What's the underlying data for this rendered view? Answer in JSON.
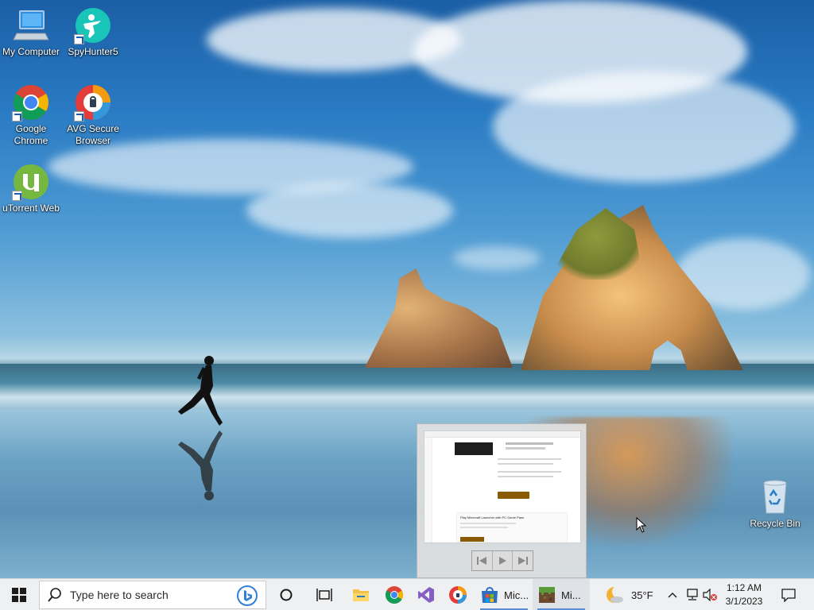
{
  "desktop": {
    "icons": [
      {
        "label": "My Computer",
        "icon": "computer-icon"
      },
      {
        "label": "SpyHunter5",
        "icon": "spyhunter-icon"
      },
      {
        "label": "Google Chrome",
        "icon": "chrome-icon"
      },
      {
        "label": "AVG Secure Browser",
        "icon": "avg-browser-icon"
      },
      {
        "label": "uTorrent Web",
        "icon": "utorrent-icon"
      },
      {
        "label": "Recycle Bin",
        "icon": "recycle-bin-icon"
      }
    ]
  },
  "preview": {
    "title": "Play Minecraft Launcher with PC Game Pass",
    "controls": [
      "previous-icon",
      "play-icon",
      "next-icon"
    ]
  },
  "taskbar": {
    "search_placeholder": "Type here to search",
    "apps": [
      {
        "name": "cortana",
        "icon": "cortana-icon"
      },
      {
        "name": "task-view",
        "icon": "task-view-icon"
      },
      {
        "name": "file-explorer",
        "icon": "folder-icon"
      },
      {
        "name": "chrome",
        "icon": "chrome-icon"
      },
      {
        "name": "visual-studio",
        "icon": "visual-studio-icon"
      },
      {
        "name": "avg-browser",
        "icon": "avg-browser-icon"
      },
      {
        "name": "microsoft-store",
        "icon": "store-icon",
        "label": "Mic..."
      },
      {
        "name": "minecraft",
        "icon": "minecraft-icon",
        "label": "Mi..."
      }
    ],
    "weather": {
      "temp": "35°F",
      "icon": "moon-icon"
    },
    "clock": {
      "time": "1:12 AM",
      "date": "3/1/2023"
    }
  },
  "colors": {
    "taskbar_bg": "#eef0f2",
    "running_indicator": "#5c8ed6",
    "sky": "#2a7cc4"
  }
}
